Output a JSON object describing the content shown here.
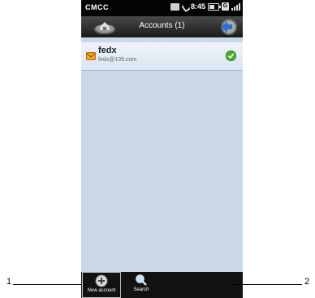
{
  "status_bar": {
    "carrier": "CMCC",
    "time": "8:45",
    "network_badge": "G",
    "battery_level": 0.6
  },
  "title_bar": {
    "title": "Accounts (1)",
    "left_icon": "home-icon",
    "right_icon": "back-arrow-icon"
  },
  "accounts": [
    {
      "name": "fedx",
      "email": "fedx@139.com",
      "status_icon": "check-icon"
    }
  ],
  "toolbar": {
    "new_account_label": "New account",
    "search_label": "Search"
  },
  "callouts": {
    "left": "1",
    "right": "2"
  },
  "colors": {
    "content_bg": "#c9d7e7",
    "check_green": "#4caf2e"
  }
}
